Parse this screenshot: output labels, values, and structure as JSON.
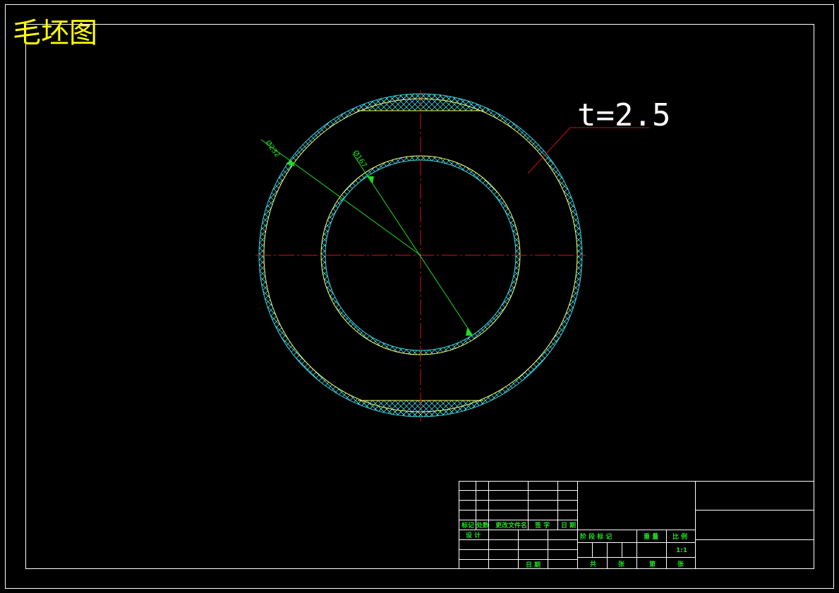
{
  "drawing": {
    "title": "毛坯图",
    "thickness_label": "t=2.5",
    "dim_outer": "Ø232",
    "dim_inner": "Ø167",
    "colors": {
      "background": "#000000",
      "border": "#ffffff",
      "title": "#ffff00",
      "outline": "#ffff66",
      "hatch": "#3fd6e0",
      "center_line": "#d01818",
      "leader": "#cc1111",
      "dimension": "#22dd22",
      "title_block_text": "#22dd22"
    }
  },
  "title_block": {
    "revision_headers": [
      "标记",
      "处数",
      "更改文件名",
      "签 字",
      "日 期"
    ],
    "design": "设 计",
    "date": "日 期",
    "stage_mark": "阶 段 标 记",
    "weight": "重 量",
    "scale": "比 例",
    "scale_value": "1:1",
    "total": "共",
    "sheet_unit_1": "张",
    "sheet_no": "第",
    "sheet_unit_2": "张"
  }
}
